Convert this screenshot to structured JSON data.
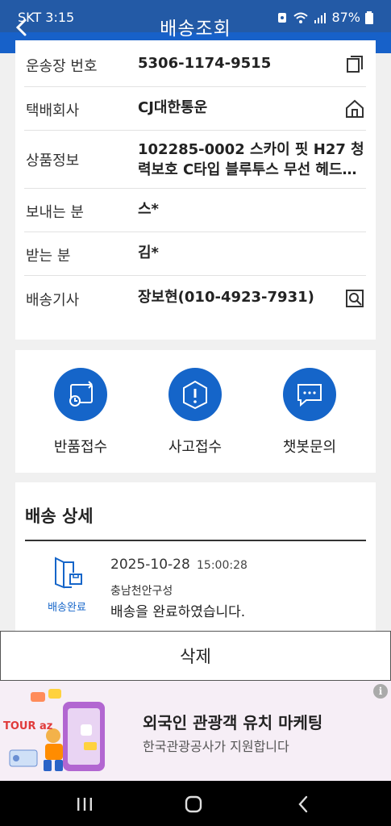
{
  "status": {
    "carrier": "SKT 3:15",
    "battery": "87%"
  },
  "header": {
    "title": "배송조회"
  },
  "info": [
    {
      "label": "운송장 번호",
      "value": "5306-1174-9515",
      "action_icon": "copy-icon"
    },
    {
      "label": "택배회사",
      "value": "CJ대한통운",
      "action_icon": "home-icon"
    },
    {
      "label": "상품정보",
      "value_line1": "102285-0002 스카이 핏 H27 청",
      "value_line2": "력보호 C타입 블루투스 무선 헤드…"
    },
    {
      "label": "보내는 분",
      "value": "스*"
    },
    {
      "label": "받는 분",
      "value": "김*"
    },
    {
      "label": "배송기사",
      "value": "장보현(010-4923-7931)",
      "action_icon": "search-icon"
    }
  ],
  "actions": [
    {
      "label": "반품접수",
      "icon": "return-icon"
    },
    {
      "label": "사고접수",
      "icon": "alert-box-icon"
    },
    {
      "label": "챗봇문의",
      "icon": "chat-icon"
    }
  ],
  "detail": {
    "title": "배송 상세",
    "status_label": "배송완료",
    "date": "2025-10-28",
    "time": "15:00:28",
    "location": "충남천안구성",
    "message": "배송을 완료하였습니다."
  },
  "delete_label": "삭제",
  "ad": {
    "brand": "TOUR az",
    "line1": "외국인 관광객 유치 마케팅",
    "line2": "한국관광공사가 지원합니다",
    "info_glyph": "i"
  },
  "colors": {
    "header": "#1761c9",
    "accent": "#1565c9"
  }
}
